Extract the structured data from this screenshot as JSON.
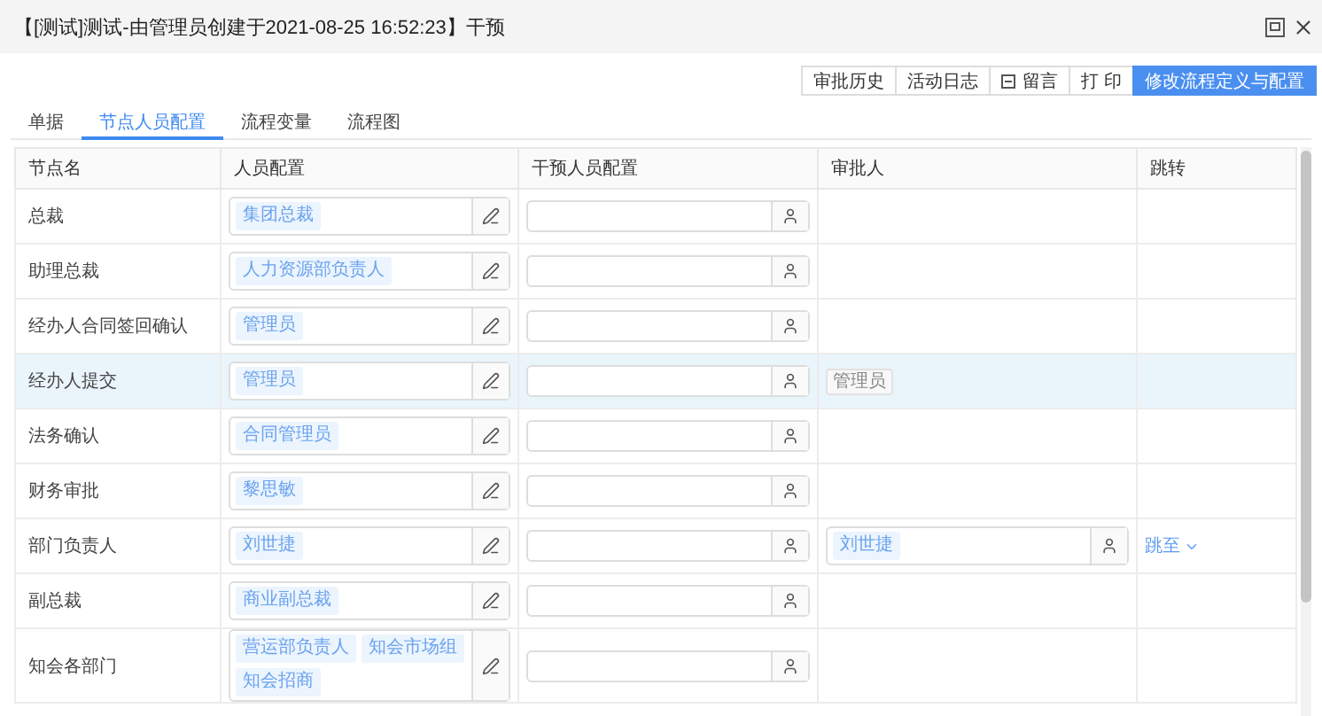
{
  "window": {
    "title": "【[测试]测试-由管理员创建于2021-08-25 16:52:23】干预"
  },
  "toolbar": [
    {
      "label": "审批历史",
      "kind": "plain"
    },
    {
      "label": "活动日志",
      "kind": "plain"
    },
    {
      "label": "留言",
      "kind": "icon"
    },
    {
      "label": "打 印",
      "kind": "plain"
    },
    {
      "label": "修改流程定义与配置",
      "kind": "primary"
    }
  ],
  "tabs": [
    {
      "label": "单据",
      "selected": false
    },
    {
      "label": "节点人员配置",
      "selected": true
    },
    {
      "label": "流程变量",
      "selected": false
    },
    {
      "label": "流程图",
      "selected": false
    }
  ],
  "table": {
    "columns": [
      "节点名",
      "人员配置",
      "干预人员配置",
      "审批人",
      "跳转"
    ],
    "rows": [
      {
        "node": "总裁",
        "selected": false,
        "staff": [
          "集团总裁"
        ]
      },
      {
        "node": "助理总裁",
        "selected": false,
        "staff": [
          "人力资源部负责人"
        ]
      },
      {
        "node": "经办人合同签回确认",
        "selected": false,
        "staff": [
          "管理员"
        ]
      },
      {
        "node": "经办人提交",
        "selected": true,
        "staff": [
          "管理员"
        ],
        "approver": {
          "kind": "label",
          "names": [
            "管理员"
          ]
        }
      },
      {
        "node": "法务确认",
        "selected": false,
        "staff": [
          "合同管理员"
        ]
      },
      {
        "node": "财务审批",
        "selected": false,
        "staff": [
          "黎思敏"
        ]
      },
      {
        "node": "部门负责人",
        "selected": false,
        "staff": [
          "刘世捷"
        ],
        "approver": {
          "kind": "picker",
          "names": [
            "刘世捷"
          ]
        },
        "jump": "跳至"
      },
      {
        "node": "副总裁",
        "selected": false,
        "staff": [
          "商业副总裁"
        ]
      },
      {
        "node": "知会各部门",
        "selected": false,
        "staff": [
          "营运部负责人",
          "知会市场组",
          "知会招商"
        ]
      }
    ]
  }
}
